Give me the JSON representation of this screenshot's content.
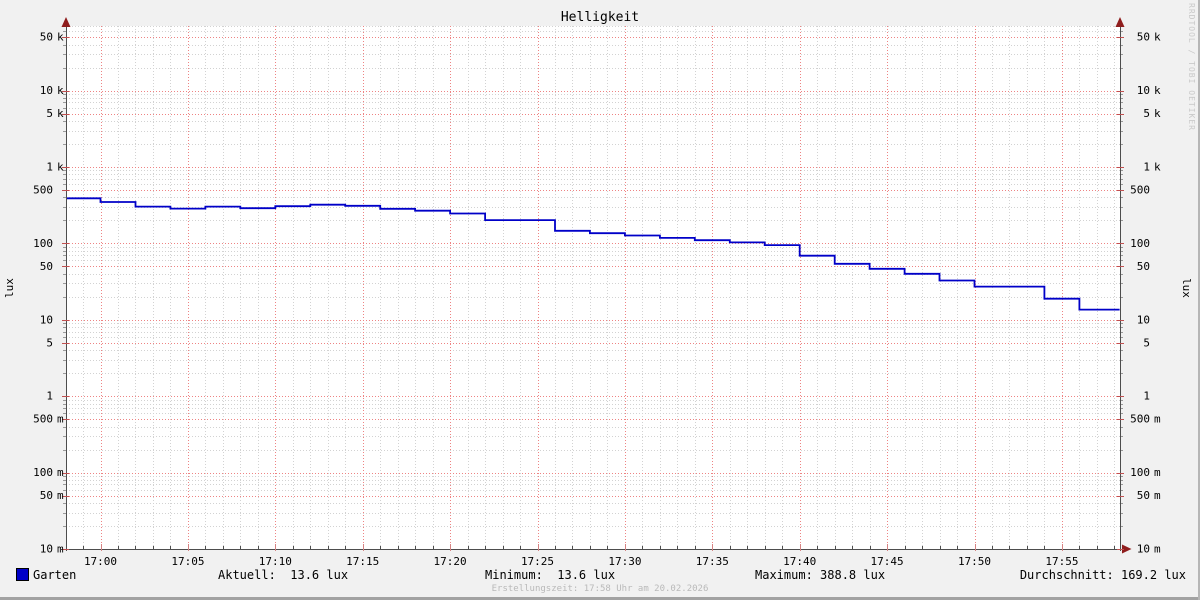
{
  "title": "Helligkeit",
  "watermark": "RRDTOOL / TOBI OETIKER",
  "footer": "Erstellungszeit: 17:58 Uhr am 20.02.2026",
  "legend": {
    "series_label": "Garten",
    "series_color": "#0000c8",
    "stats": [
      {
        "text": "Aktuell:  13.6 lux"
      },
      {
        "text": "Minimum:  13.6 lux"
      },
      {
        "text": "Maximum: 388.8 lux"
      },
      {
        "text": "Durchschnitt: 169.2 lux"
      }
    ]
  },
  "chart_data": {
    "type": "line",
    "title": "Helligkeit",
    "ylabel": "lux",
    "ylabel_right": "lux",
    "y_scale": "log",
    "ylim": [
      0.01,
      70000
    ],
    "x_range": [
      "16:58",
      "17:58"
    ],
    "x_ticks_minutes": [
      2,
      7,
      12,
      17,
      22,
      27,
      32,
      37,
      42,
      47,
      52,
      57
    ],
    "x_tick_labels": [
      "17:00",
      "17:05",
      "17:10",
      "17:15",
      "17:20",
      "17:25",
      "17:30",
      "17:35",
      "17:40",
      "17:45",
      "17:50",
      "17:55"
    ],
    "y_ticks": [
      {
        "value": 50000,
        "num": "50",
        "suffix": "k"
      },
      {
        "value": 10000,
        "num": "10",
        "suffix": "k"
      },
      {
        "value": 5000,
        "num": "5",
        "suffix": "k"
      },
      {
        "value": 1000,
        "num": "1",
        "suffix": "k"
      },
      {
        "value": 500,
        "num": "500",
        "suffix": ""
      },
      {
        "value": 100,
        "num": "100",
        "suffix": ""
      },
      {
        "value": 50,
        "num": "50",
        "suffix": ""
      },
      {
        "value": 10,
        "num": "10",
        "suffix": ""
      },
      {
        "value": 5,
        "num": "5",
        "suffix": ""
      },
      {
        "value": 1,
        "num": "1",
        "suffix": ""
      },
      {
        "value": 0.5,
        "num": "500",
        "suffix": "m"
      },
      {
        "value": 0.1,
        "num": "100",
        "suffix": "m"
      },
      {
        "value": 0.05,
        "num": "50",
        "suffix": "m"
      },
      {
        "value": 0.01,
        "num": "10",
        "suffix": "m"
      }
    ],
    "series": [
      {
        "name": "Garten",
        "color": "#0000c8",
        "steps_minute_lux": [
          [
            0,
            388.8
          ],
          [
            2,
            348
          ],
          [
            4,
            303
          ],
          [
            6,
            285
          ],
          [
            8,
            303
          ],
          [
            10,
            289
          ],
          [
            12,
            307
          ],
          [
            14,
            321
          ],
          [
            16,
            311
          ],
          [
            18,
            284
          ],
          [
            20,
            268
          ],
          [
            22,
            246
          ],
          [
            24,
            202
          ],
          [
            28,
            146
          ],
          [
            30,
            136
          ],
          [
            32,
            127
          ],
          [
            34,
            118
          ],
          [
            36,
            110
          ],
          [
            38,
            103
          ],
          [
            40,
            95
          ],
          [
            42,
            69
          ],
          [
            44,
            54
          ],
          [
            46,
            46.5
          ],
          [
            48,
            40
          ],
          [
            50,
            32.7
          ],
          [
            52,
            27.2
          ],
          [
            56,
            18.9
          ],
          [
            58,
            13.6
          ]
        ],
        "end_minute": 60.3
      }
    ],
    "stats": {
      "aktuell": 13.6,
      "minimum": 13.6,
      "maximum": 388.8,
      "durchschnitt": 169.2,
      "unit": "lux"
    },
    "grid": true,
    "legend_position": "bottom-left"
  },
  "colors": {
    "background": "#f1f1f1",
    "plot_background": "#ffffff",
    "grid_minor": "#d2d2d2",
    "grid_major": "#ee8383",
    "axis": "#4d4d4d",
    "arrow": "#8f1d1d",
    "tick_minor": "#9a9a9a",
    "series": "#0000c8",
    "text": "#000000",
    "footer_text": "#b9b9b9",
    "watermark_text": "#c9c9c9"
  }
}
